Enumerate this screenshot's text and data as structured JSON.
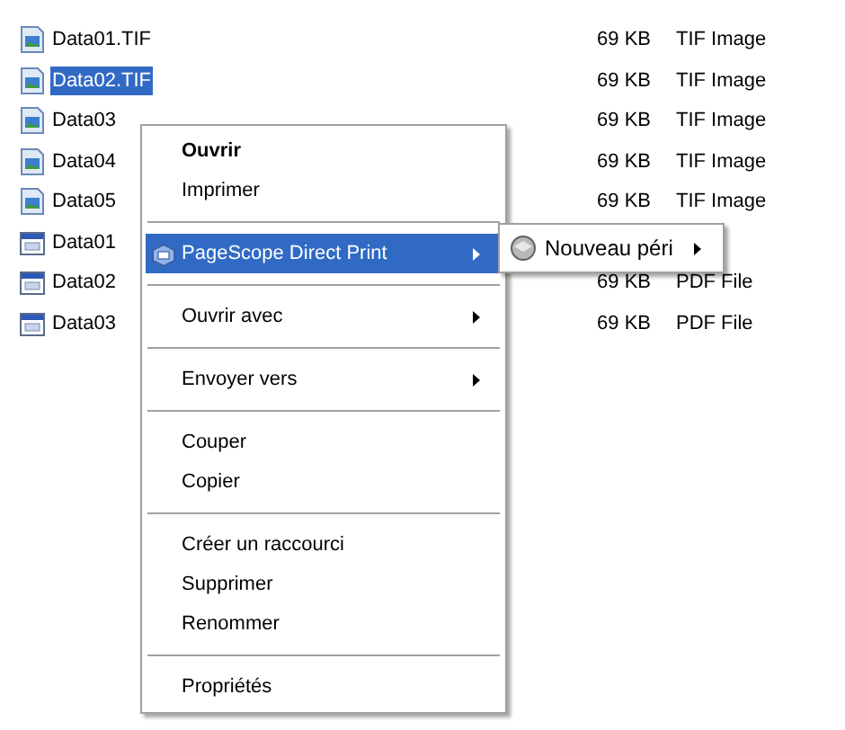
{
  "files": [
    {
      "name": "Data01.TIF",
      "kind": "image",
      "size": "69 KB",
      "type": "TIF Image",
      "selected": false
    },
    {
      "name": "Data02.TIF",
      "kind": "image",
      "size": "69 KB",
      "type": "TIF Image",
      "selected": true
    },
    {
      "name": "Data03",
      "kind": "image",
      "size": "69 KB",
      "type": "TIF Image",
      "selected": false
    },
    {
      "name": "Data04",
      "kind": "image",
      "size": "69 KB",
      "type": "TIF Image",
      "selected": false
    },
    {
      "name": "Data05",
      "kind": "image",
      "size": "69 KB",
      "type": "TIF Image",
      "selected": false
    },
    {
      "name": "Data01",
      "kind": "document",
      "selected": false
    },
    {
      "name": "Data02",
      "kind": "document",
      "size": "69 KB",
      "type": "PDF File",
      "selected": false
    },
    {
      "name": "Data03",
      "kind": "document",
      "size": "69 KB",
      "type": "PDF File",
      "selected": false
    }
  ],
  "context_menu": [
    {
      "kind": "item",
      "label": "Ouvrir",
      "default": true,
      "selected": false,
      "submenu": false
    },
    {
      "kind": "item",
      "label": "Imprimer",
      "default": false,
      "selected": false,
      "submenu": false
    },
    {
      "kind": "separator"
    },
    {
      "kind": "item",
      "label": "PageScope Direct Print",
      "icon": true,
      "default": false,
      "selected": true,
      "submenu": true
    },
    {
      "kind": "separator"
    },
    {
      "kind": "item",
      "label": "Ouvrir avec",
      "default": false,
      "selected": false,
      "submenu": true
    },
    {
      "kind": "separator"
    },
    {
      "kind": "item",
      "label": "Envoyer vers",
      "default": false,
      "selected": false,
      "submenu": true
    },
    {
      "kind": "separator"
    },
    {
      "kind": "item",
      "label": "Couper",
      "default": false,
      "selected": false,
      "submenu": false
    },
    {
      "kind": "item",
      "label": "Copier",
      "default": false,
      "selected": false,
      "submenu": false
    },
    {
      "kind": "separator"
    },
    {
      "kind": "item",
      "label": "Créer un raccourci",
      "default": false,
      "selected": false,
      "submenu": false
    },
    {
      "kind": "item",
      "label": "Supprimer",
      "default": false,
      "selected": false,
      "submenu": false
    },
    {
      "kind": "item",
      "label": "Renommer",
      "default": false,
      "selected": false,
      "submenu": false
    },
    {
      "kind": "separator"
    },
    {
      "kind": "item",
      "label": "Propriétés",
      "default": false,
      "selected": false,
      "submenu": false
    }
  ],
  "submenu": [
    {
      "label": "Nouveau péri",
      "submenu": true
    }
  ]
}
